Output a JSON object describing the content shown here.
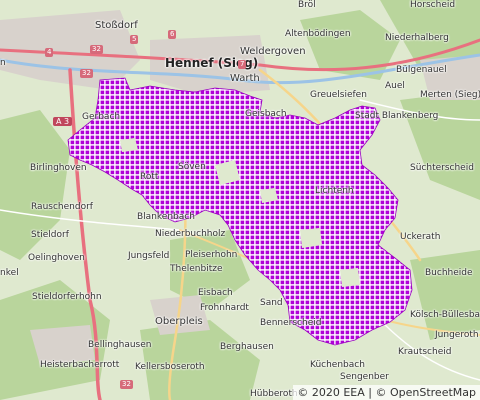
{
  "map": {
    "places": [
      {
        "id": "stossdorf",
        "name": "Stoßdorf",
        "size": "mid"
      },
      {
        "id": "hennef",
        "name": "Hennef (Sieg)",
        "size": "big"
      },
      {
        "id": "weldergoven",
        "name": "Weldergoven",
        "size": "mid"
      },
      {
        "id": "warth",
        "name": "Warth",
        "size": "mid"
      },
      {
        "id": "brol",
        "name": "Bröl",
        "size": ""
      },
      {
        "id": "horscheid",
        "name": "Horscheid",
        "size": ""
      },
      {
        "id": "altenbodingen",
        "name": "Altenbödingen",
        "size": ""
      },
      {
        "id": "niederhalberg",
        "name": "Niederhalberg",
        "size": ""
      },
      {
        "id": "bulgenauel",
        "name": "Bülgenauel",
        "size": ""
      },
      {
        "id": "greuelsiefen",
        "name": "Greuelsiefen",
        "size": ""
      },
      {
        "id": "auel",
        "name": "Auel",
        "size": ""
      },
      {
        "id": "merten",
        "name": "Merten (Sieg)",
        "size": ""
      },
      {
        "id": "blankenberg",
        "name": "Stadt Blankenberg",
        "size": ""
      },
      {
        "id": "suchterscheid",
        "name": "Süchterscheid",
        "size": ""
      },
      {
        "id": "birlinghoven",
        "name": "Birlinghoven",
        "size": ""
      },
      {
        "id": "rauschendorf",
        "name": "Rauschendorf",
        "size": ""
      },
      {
        "id": "stieldorf",
        "name": "Stieldorf",
        "size": ""
      },
      {
        "id": "oelinghoven",
        "name": "Oelinghoven",
        "size": ""
      },
      {
        "id": "nkel",
        "name": "nkel",
        "size": ""
      },
      {
        "id": "stieldorferhohn",
        "name": "Stieldorferhohn",
        "size": ""
      },
      {
        "id": "bellinghausen",
        "name": "Bellinghausen",
        "size": ""
      },
      {
        "id": "heisterbacherrott",
        "name": "Heisterbacherrott",
        "size": ""
      },
      {
        "id": "kellersboseroth",
        "name": "Kellersboseroth",
        "size": ""
      },
      {
        "id": "hubberoth",
        "name": "Hübberoth",
        "size": ""
      },
      {
        "id": "gerbach",
        "name": "Gerbach",
        "size": ""
      },
      {
        "id": "geisbach",
        "name": "Geisbach",
        "size": ""
      },
      {
        "id": "sovel",
        "name": "Söven",
        "size": ""
      },
      {
        "id": "rott",
        "name": "Rott",
        "size": ""
      },
      {
        "id": "blankenbach",
        "name": "Blankenbach",
        "size": ""
      },
      {
        "id": "niederbuchholz",
        "name": "Niederbuchholz",
        "size": ""
      },
      {
        "id": "jungsfeld",
        "name": "Jungsfeld",
        "size": ""
      },
      {
        "id": "pleiserhohn",
        "name": "Pleiserhohn",
        "size": ""
      },
      {
        "id": "thelenbitze",
        "name": "Thelenbitze",
        "size": ""
      },
      {
        "id": "eisbach",
        "name": "Eisbach",
        "size": ""
      },
      {
        "id": "frohnhardt",
        "name": "Frohnhardt",
        "size": ""
      },
      {
        "id": "sand",
        "name": "Sand",
        "size": ""
      },
      {
        "id": "oberpleis",
        "name": "Oberpleis",
        "size": "mid"
      },
      {
        "id": "bennerscheid",
        "name": "Bennerscheid",
        "size": ""
      },
      {
        "id": "berghausen",
        "name": "Berghausen",
        "size": ""
      },
      {
        "id": "lichtenh",
        "name": "Lichtenh",
        "size": ""
      },
      {
        "id": "uckerath",
        "name": "Uckerath",
        "size": ""
      },
      {
        "id": "buchheide",
        "name": "Buchheide",
        "size": ""
      },
      {
        "id": "kolsch",
        "name": "Kölsch-Büllesbach",
        "size": ""
      },
      {
        "id": "jungeroth",
        "name": "Jungeroth",
        "size": ""
      },
      {
        "id": "kuchenbach",
        "name": "Küchenbach",
        "size": ""
      },
      {
        "id": "krautscheid",
        "name": "Krautscheid",
        "size": ""
      },
      {
        "id": "sengenber",
        "name": "Sengenber",
        "size": ""
      },
      {
        "id": "n",
        "name": "n",
        "size": ""
      }
    ],
    "shields": [
      {
        "id": "a3",
        "text": "A 3",
        "type": "mot"
      },
      {
        "id": "r32a",
        "text": "32"
      },
      {
        "id": "r32b",
        "text": "32"
      },
      {
        "id": "r32c",
        "text": "32"
      },
      {
        "id": "r4",
        "text": "4"
      },
      {
        "id": "r5",
        "text": "5"
      },
      {
        "id": "r6",
        "text": "6"
      },
      {
        "id": "r7",
        "text": "7"
      }
    ],
    "attribution": "© 2020 EEA | © OpenStreetMap",
    "colors": {
      "protected_area": "#b000d8",
      "forest": "#b9d59c",
      "urban": "#d8d2cc",
      "motorway": "#e8707f",
      "road": "#f6d58a"
    }
  }
}
